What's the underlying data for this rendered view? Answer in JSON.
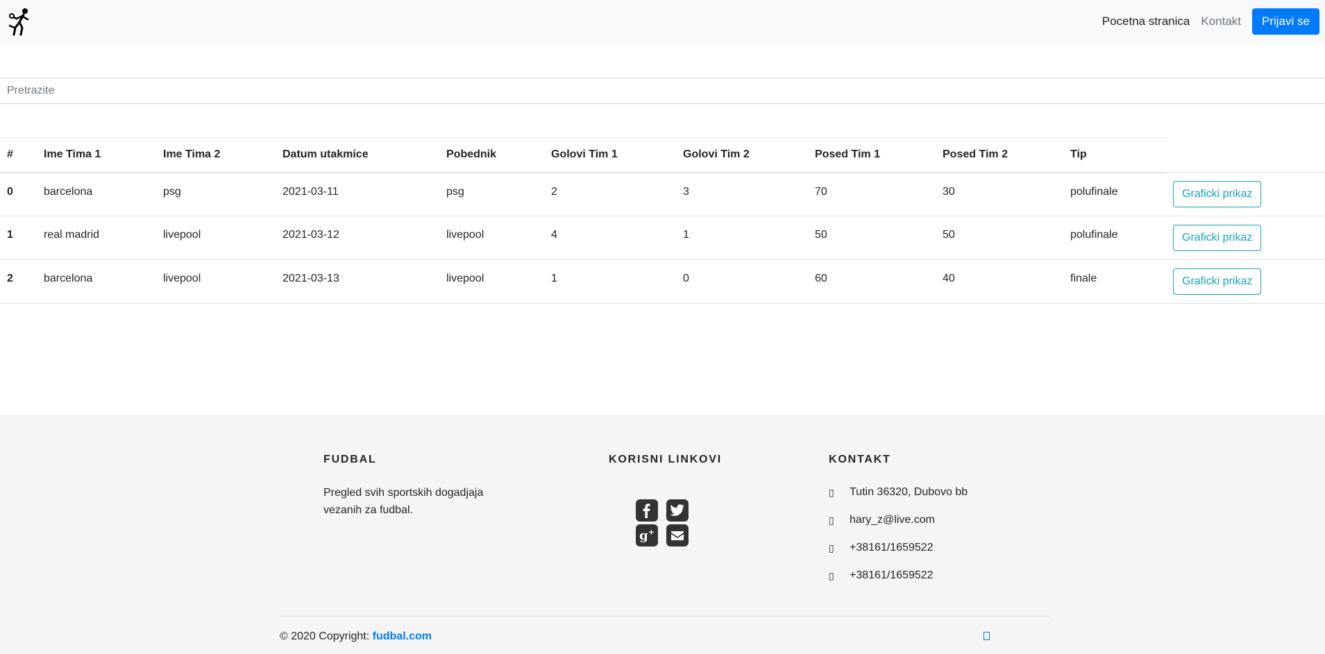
{
  "navbar": {
    "brand_icon": "soccer-player-icon",
    "links": [
      {
        "label": "Pocetna stranica",
        "state": "active"
      },
      {
        "label": "Kontakt",
        "state": "muted"
      }
    ],
    "login_label": "Prijavi se",
    "accent_color": "#007bff"
  },
  "search": {
    "placeholder": "Pretrazite",
    "value": ""
  },
  "table": {
    "headers": [
      "#",
      "Ime Tima 1",
      "Ime Tima 2",
      "Datum utakmice",
      "Pobednik",
      "Golovi Tim 1",
      "Golovi Tim 2",
      "Posed Tim 1",
      "Posed Tim 2",
      "Tip"
    ],
    "rows": [
      {
        "idx": "0",
        "team1": "barcelona",
        "team2": "psg",
        "date": "2021-03-11",
        "winner": "psg",
        "goals1": "2",
        "goals2": "3",
        "pos1": "70",
        "pos2": "30",
        "type": "polufinale"
      },
      {
        "idx": "1",
        "team1": "real madrid",
        "team2": "livepool",
        "date": "2021-03-12",
        "winner": "livepool",
        "goals1": "4",
        "goals2": "1",
        "pos1": "50",
        "pos2": "50",
        "type": "polufinale"
      },
      {
        "idx": "2",
        "team1": "barcelona",
        "team2": "livepool",
        "date": "2021-03-13",
        "winner": "livepool",
        "goals1": "1",
        "goals2": "0",
        "pos1": "60",
        "pos2": "40",
        "type": "finale"
      }
    ],
    "row_button_label": "Graficki prikaz",
    "row_button_color": "#17a2b8"
  },
  "footer": {
    "about": {
      "heading": "FUDBAL",
      "text": "Pregled svih sportskih dogadjaja vezanih za fudbal."
    },
    "links": {
      "heading": "KORISNI LINKOVI",
      "social": [
        "facebook-icon",
        "twitter-icon",
        "google-plus-icon",
        "envelope-icon"
      ]
    },
    "contact": {
      "heading": "KONTAKT",
      "items": [
        {
          "icon": "home-icon",
          "text": "Tutin 36320, Dubovo bb"
        },
        {
          "icon": "envelope-icon",
          "text": "hary_z@live.com"
        },
        {
          "icon": "phone-icon",
          "text": "+38161/1659522"
        },
        {
          "icon": "print-icon",
          "text": "+38161/1659522"
        }
      ]
    },
    "copyright_prefix": "© 2020 Copyright:",
    "copyright_link": "fudbal.com",
    "background_color": "#f5f5f5"
  }
}
